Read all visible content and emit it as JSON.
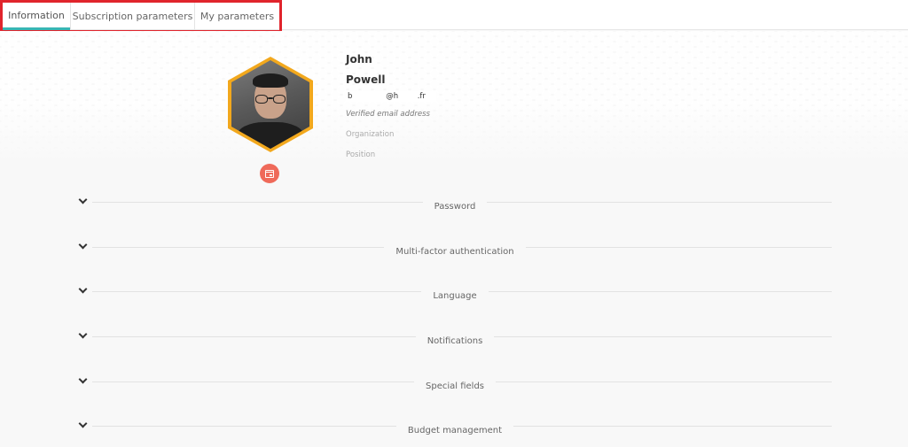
{
  "tabs": [
    {
      "label": "Information",
      "active": true
    },
    {
      "label": "Subscription parameters",
      "active": false
    },
    {
      "label": "My parameters",
      "active": false
    }
  ],
  "profile": {
    "first_name": "John",
    "last_name": "Powell",
    "email": "b              @h        .fr",
    "email_status": "Verified email address",
    "organization_placeholder": "Organization",
    "position_placeholder": "Position"
  },
  "sections": [
    {
      "label": "Password"
    },
    {
      "label": "Multi-factor authentication"
    },
    {
      "label": "Language"
    },
    {
      "label": "Notifications"
    },
    {
      "label": "Special fields"
    },
    {
      "label": "Budget management"
    }
  ],
  "colors": {
    "active_tab_underline": "#38b6b4",
    "highlight_border": "#e0242c",
    "avatar_border": "#f2a81d",
    "avatar_action": "#ef6a5a"
  },
  "icons": {
    "avatar_action": "calendar-icon",
    "section_toggle": "chevron-down-icon"
  }
}
